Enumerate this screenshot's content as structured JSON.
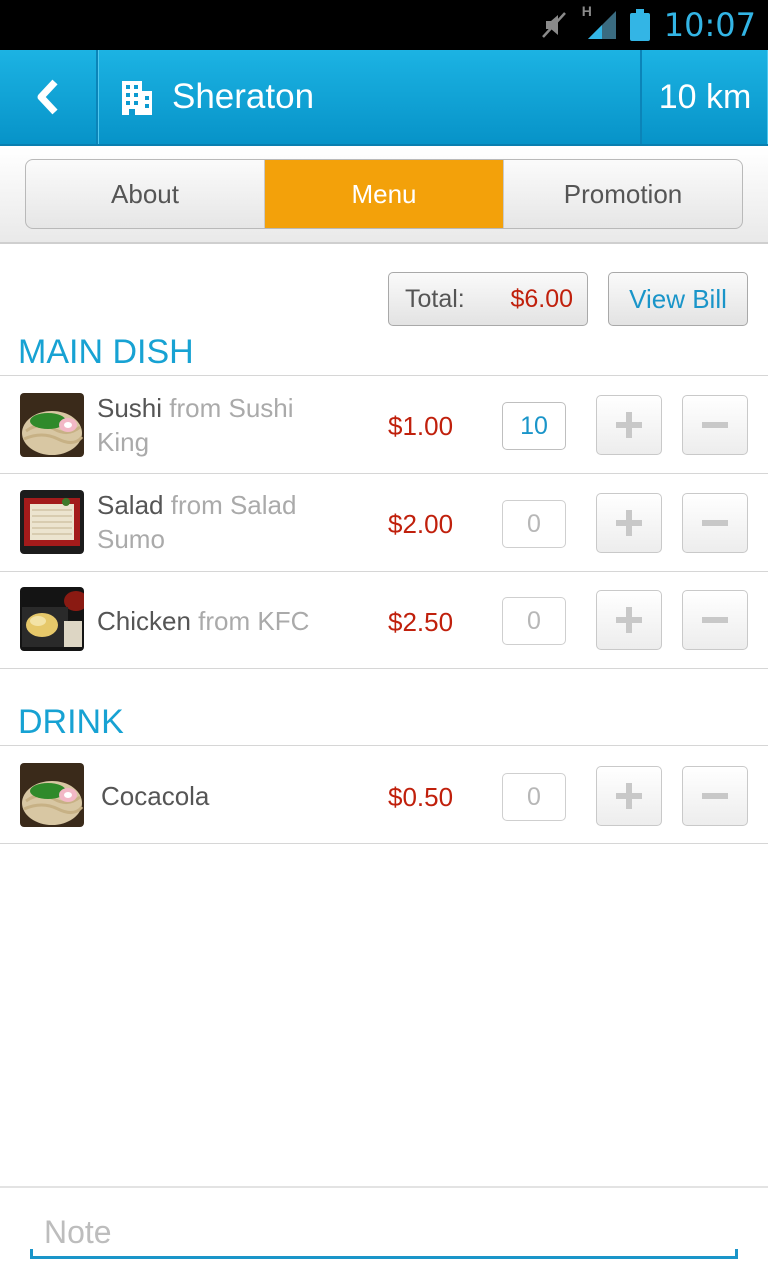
{
  "status_bar": {
    "time": "10:07",
    "network": "H",
    "icons": [
      "mute-icon",
      "signal-icon",
      "battery-icon"
    ]
  },
  "header": {
    "title": "Sheraton",
    "distance": "10 km",
    "icons": [
      "back-icon",
      "building-icon"
    ]
  },
  "tabs": [
    {
      "label": "About",
      "active": false
    },
    {
      "label": "Menu",
      "active": true
    },
    {
      "label": "Promotion",
      "active": false
    }
  ],
  "summary": {
    "total_label": "Total:",
    "total_value": "$6.00",
    "view_bill_label": "View Bill"
  },
  "sections": [
    {
      "title": "MAIN DISH",
      "items": [
        {
          "name": "Sushi",
          "from": "from Sushi King",
          "price": "$1.00",
          "qty": "10"
        },
        {
          "name": "Salad",
          "from": "from Salad Sumo",
          "price": "$2.00",
          "qty": "0"
        },
        {
          "name": "Chicken",
          "from": "from KFC",
          "price": "$2.50",
          "qty": "0"
        }
      ]
    },
    {
      "title": "DRINK",
      "items": [
        {
          "name": "Cocacola",
          "from": "",
          "price": "$0.50",
          "qty": "0"
        }
      ]
    }
  ],
  "note": {
    "placeholder": "Note",
    "value": ""
  },
  "colors": {
    "accent": "#1a95c9",
    "tab_active": "#f3a10a",
    "price": "#c0200c",
    "header": "#0793c8"
  }
}
